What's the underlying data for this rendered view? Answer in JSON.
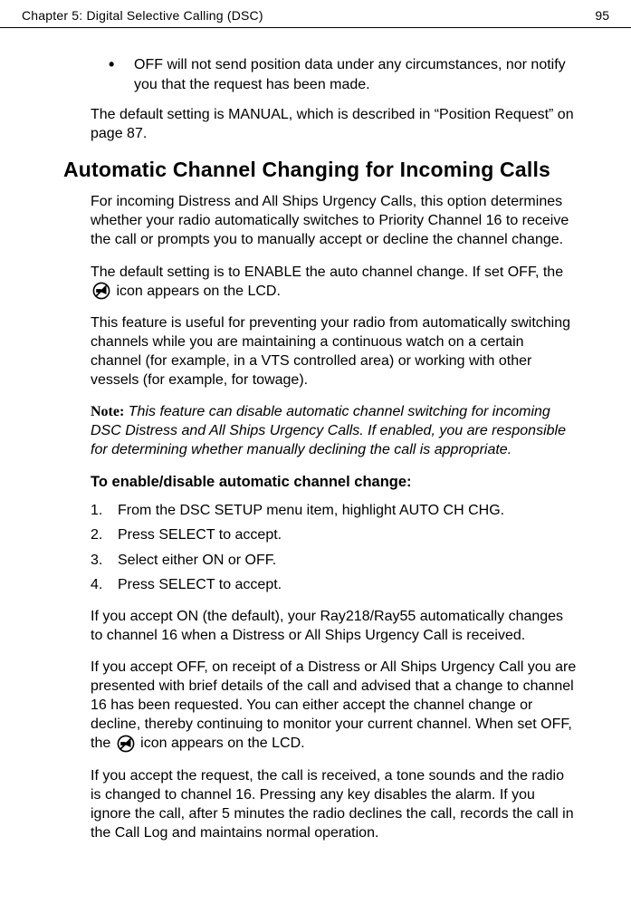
{
  "header": {
    "chapter_label": "Chapter 5: Digital Selective Calling (DSC)",
    "page_number": "95"
  },
  "bullet_off": "OFF will not send position data under any circumstances, nor notify you that the request has been made.",
  "default_manual": "The default setting is MANUAL, which is described in “Position Request” on page 87.",
  "heading_auto": "Automatic Channel Changing for Incoming Calls",
  "p1": "For incoming Distress and All Ships Urgency Calls, this option determines whether your radio automatically switches to Priority Channel 16 to receive the call or prompts you to manually accept or decline the channel change.",
  "p2a": "The default setting is to ENABLE the auto channel change. If set OFF, the",
  "p2b": "icon appears on the LCD.",
  "p3": "This feature is useful for preventing your radio from automatically switching channels while you are maintaining a continuous watch on a certain channel (for example, in a VTS controlled area) or working with other vessels (for example, for towage).",
  "note_label": "Note:",
  "note_text": "This feature can disable automatic channel switching for incoming DSC Distress and All Ships Urgency Calls. If enabled, you are responsible for determining whether manually declining the call is appropriate.",
  "subhead": "To enable/disable automatic channel change:",
  "steps": {
    "s1n": "1.",
    "s1t": "From the DSC SETUP menu item, highlight AUTO CH CHG.",
    "s2n": "2.",
    "s2t": "Press SELECT to accept.",
    "s3n": "3.",
    "s3t": "Select either ON or OFF.",
    "s4n": "4.",
    "s4t": "Press SELECT to accept."
  },
  "p_on": "If you accept ON (the default), your Ray218/Ray55 automatically changes to channel 16 when a Distress or All Ships Urgency Call is received.",
  "p_off_a": "If you accept OFF, on receipt of a Distress or All Ships Urgency Call you are presented with brief details of the call and advised that a change to channel 16 has been requested. You can either accept the channel change or decline, thereby continuing to monitor your current channel. When set OFF, the",
  "p_off_b": "icon appears on the LCD.",
  "p_accept": "If you accept the request, the call is received, a tone sounds and the radio is changed to channel 16. Pressing any key disables the alarm. If you ignore the call, after 5 minutes the radio declines the call, records the call in the Call Log and maintains normal operation."
}
